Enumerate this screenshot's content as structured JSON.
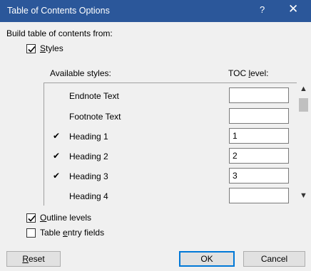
{
  "window": {
    "title": "Table of Contents Options",
    "help_glyph": "?",
    "close_glyph": "✕"
  },
  "build_label": "Build table of contents from:",
  "styles": {
    "label_u": "S",
    "label_rest": "tyles",
    "checked": true
  },
  "columns": {
    "available": "Available styles:",
    "toc_level_pre": "TOC ",
    "toc_level_u": "l",
    "toc_level_post": "evel:"
  },
  "rows": [
    {
      "name": "Endnote Text",
      "mark": "",
      "level": ""
    },
    {
      "name": "Footnote Text",
      "mark": "",
      "level": ""
    },
    {
      "name": "Heading 1",
      "mark": "✔",
      "level": "1"
    },
    {
      "name": "Heading 2",
      "mark": "✔",
      "level": "2"
    },
    {
      "name": "Heading 3",
      "mark": "✔",
      "level": "3"
    },
    {
      "name": "Heading 4",
      "mark": "",
      "level": ""
    }
  ],
  "scroll": {
    "up_glyph": "▲",
    "down_glyph": "▼"
  },
  "outline": {
    "label_u": "O",
    "label_rest": "utline levels",
    "checked": true
  },
  "table_entry": {
    "label_pre": "Table ",
    "label_u": "e",
    "label_rest": "ntry fields",
    "checked": false
  },
  "buttons": {
    "reset_u": "R",
    "reset_rest": "eset",
    "ok": "OK",
    "cancel": "Cancel"
  }
}
